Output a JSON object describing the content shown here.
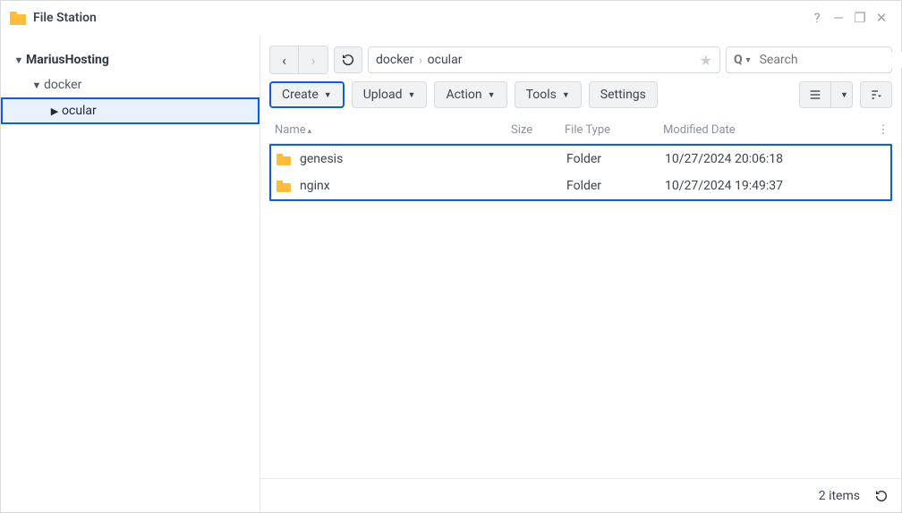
{
  "app_title": "File Station",
  "window_controls": {
    "help": "?",
    "min": "—",
    "max": "❐",
    "close": "✕"
  },
  "tree": {
    "root": "MariusHosting",
    "l1": "docker",
    "l2": "ocular"
  },
  "nav": {
    "back": "‹",
    "forward": "›"
  },
  "breadcrumb": {
    "seg1": "docker",
    "seg2": "ocular",
    "sep": "›"
  },
  "search": {
    "placeholder": "Search"
  },
  "toolbar": {
    "create": "Create",
    "upload": "Upload",
    "action": "Action",
    "tools": "Tools",
    "settings": "Settings"
  },
  "columns": {
    "name": "Name",
    "size": "Size",
    "type": "File Type",
    "date": "Modified Date"
  },
  "rows": [
    {
      "name": "genesis",
      "size": "",
      "type": "Folder",
      "date": "10/27/2024 20:06:18"
    },
    {
      "name": "nginx",
      "size": "",
      "type": "Folder",
      "date": "10/27/2024 19:49:37"
    }
  ],
  "status": {
    "count": "2 items"
  }
}
